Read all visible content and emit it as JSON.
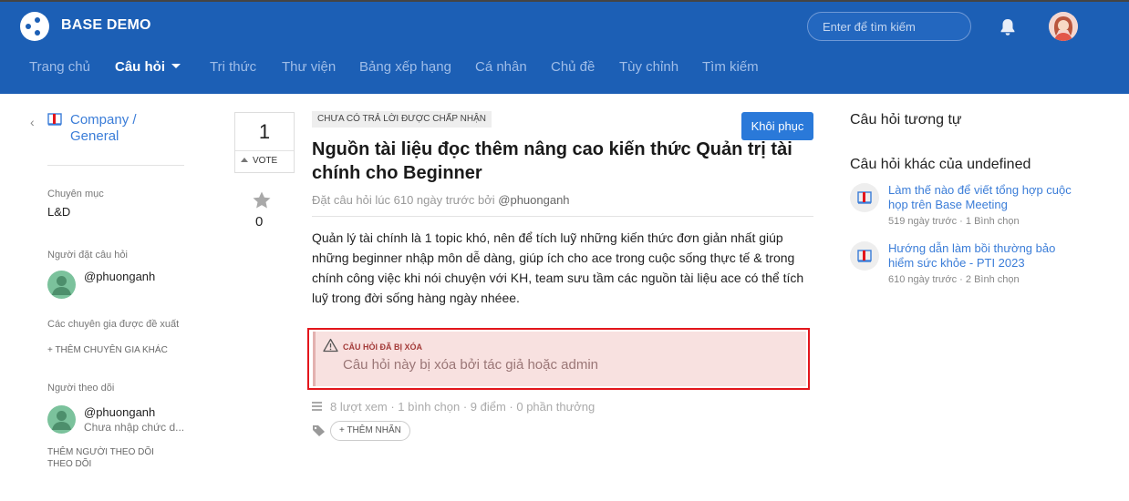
{
  "brand": "BASE DEMO",
  "search": {
    "placeholder": "Enter để tìm kiếm"
  },
  "nav": [
    "Trang chủ",
    "Câu hỏi",
    "Tri thức",
    "Thư viện",
    "Bảng xếp hạng",
    "Cá nhân",
    "Chủ đề",
    "Tùy chỉnh",
    "Tìm kiếm"
  ],
  "sidebar": {
    "category": "Company / General",
    "category_line1": "Company /",
    "category_line2": "General",
    "field_label": "Chuyên mục",
    "field_value": "L&D",
    "asker_label": "Người đặt câu hỏi",
    "asker": "@phuonganh",
    "experts_label": "Các chuyên gia được đề xuất",
    "add_expert": "+ THÊM CHUYÊN GIA KHÁC",
    "followers_label": "Người theo dõi",
    "follower_name": "@phuonganh",
    "follower_sub": "Chưa nhập chức d...",
    "add_follower_line1": "THÊM NGƯỜI THEO DÕI",
    "add_follower_line2": "THEO DÕI"
  },
  "vote": {
    "count": "1",
    "label": "VOTE",
    "stars": "0"
  },
  "question": {
    "status": "CHƯA CÓ TRẢ LỜI ĐƯỢC CHẤP NHẬN",
    "restore_label": "Khôi phục",
    "title": "Nguồn tài liệu đọc thêm nâng cao kiến thức Quản trị tài chính cho Beginner",
    "meta_prefix": "Đặt câu hỏi lúc 610 ngày trước bởi",
    "meta_author": "@phuonganh",
    "body": "Quản lý tài chính là 1 topic khó, nên để tích luỹ những kiến thức đơn giản nhất giúp những beginner nhập môn dễ dàng, giúp ích cho ace trong cuộc sống thực tế & trong chính công việc khi nói chuyện với KH, team sưu tầm các nguồn tài liệu ace có thể tích luỹ trong đời sống hàng ngày nhéee.",
    "deleted_title": "CÂU HỎI ĐÃ BỊ XÓA",
    "deleted_msg": "Câu hỏi này bị xóa bởi tác giả hoặc admin",
    "stats": "8 lượt xem · 1 bình chọn · 9 điểm · 0 phần thưởng",
    "add_tag": "+ THÊM NHÃN"
  },
  "right": {
    "similar_heading": "Câu hỏi tương tự",
    "other_heading": "Câu hỏi khác của undefined",
    "items": [
      {
        "title": "Làm thế nào để viết tổng hợp cuộc họp trên Base Meeting",
        "meta": "519 ngày trước · 1 Bình chọn"
      },
      {
        "title": "Hướng dẫn làm bồi thường bảo hiểm sức khỏe - PTI 2023",
        "meta": "610 ngày trước · 2 Bình chọn"
      }
    ]
  },
  "colors": {
    "header": "#1c5fb5",
    "link": "#3b7dd8",
    "danger": "#e3161c",
    "primary_button": "#2a79d9"
  },
  "icons": [
    "app-logo-icon",
    "bell-icon",
    "user-avatar-icon",
    "chevron-left-icon",
    "book-icon",
    "vote-up-icon",
    "star-icon",
    "warning-icon",
    "list-icon",
    "tag-icon"
  ]
}
